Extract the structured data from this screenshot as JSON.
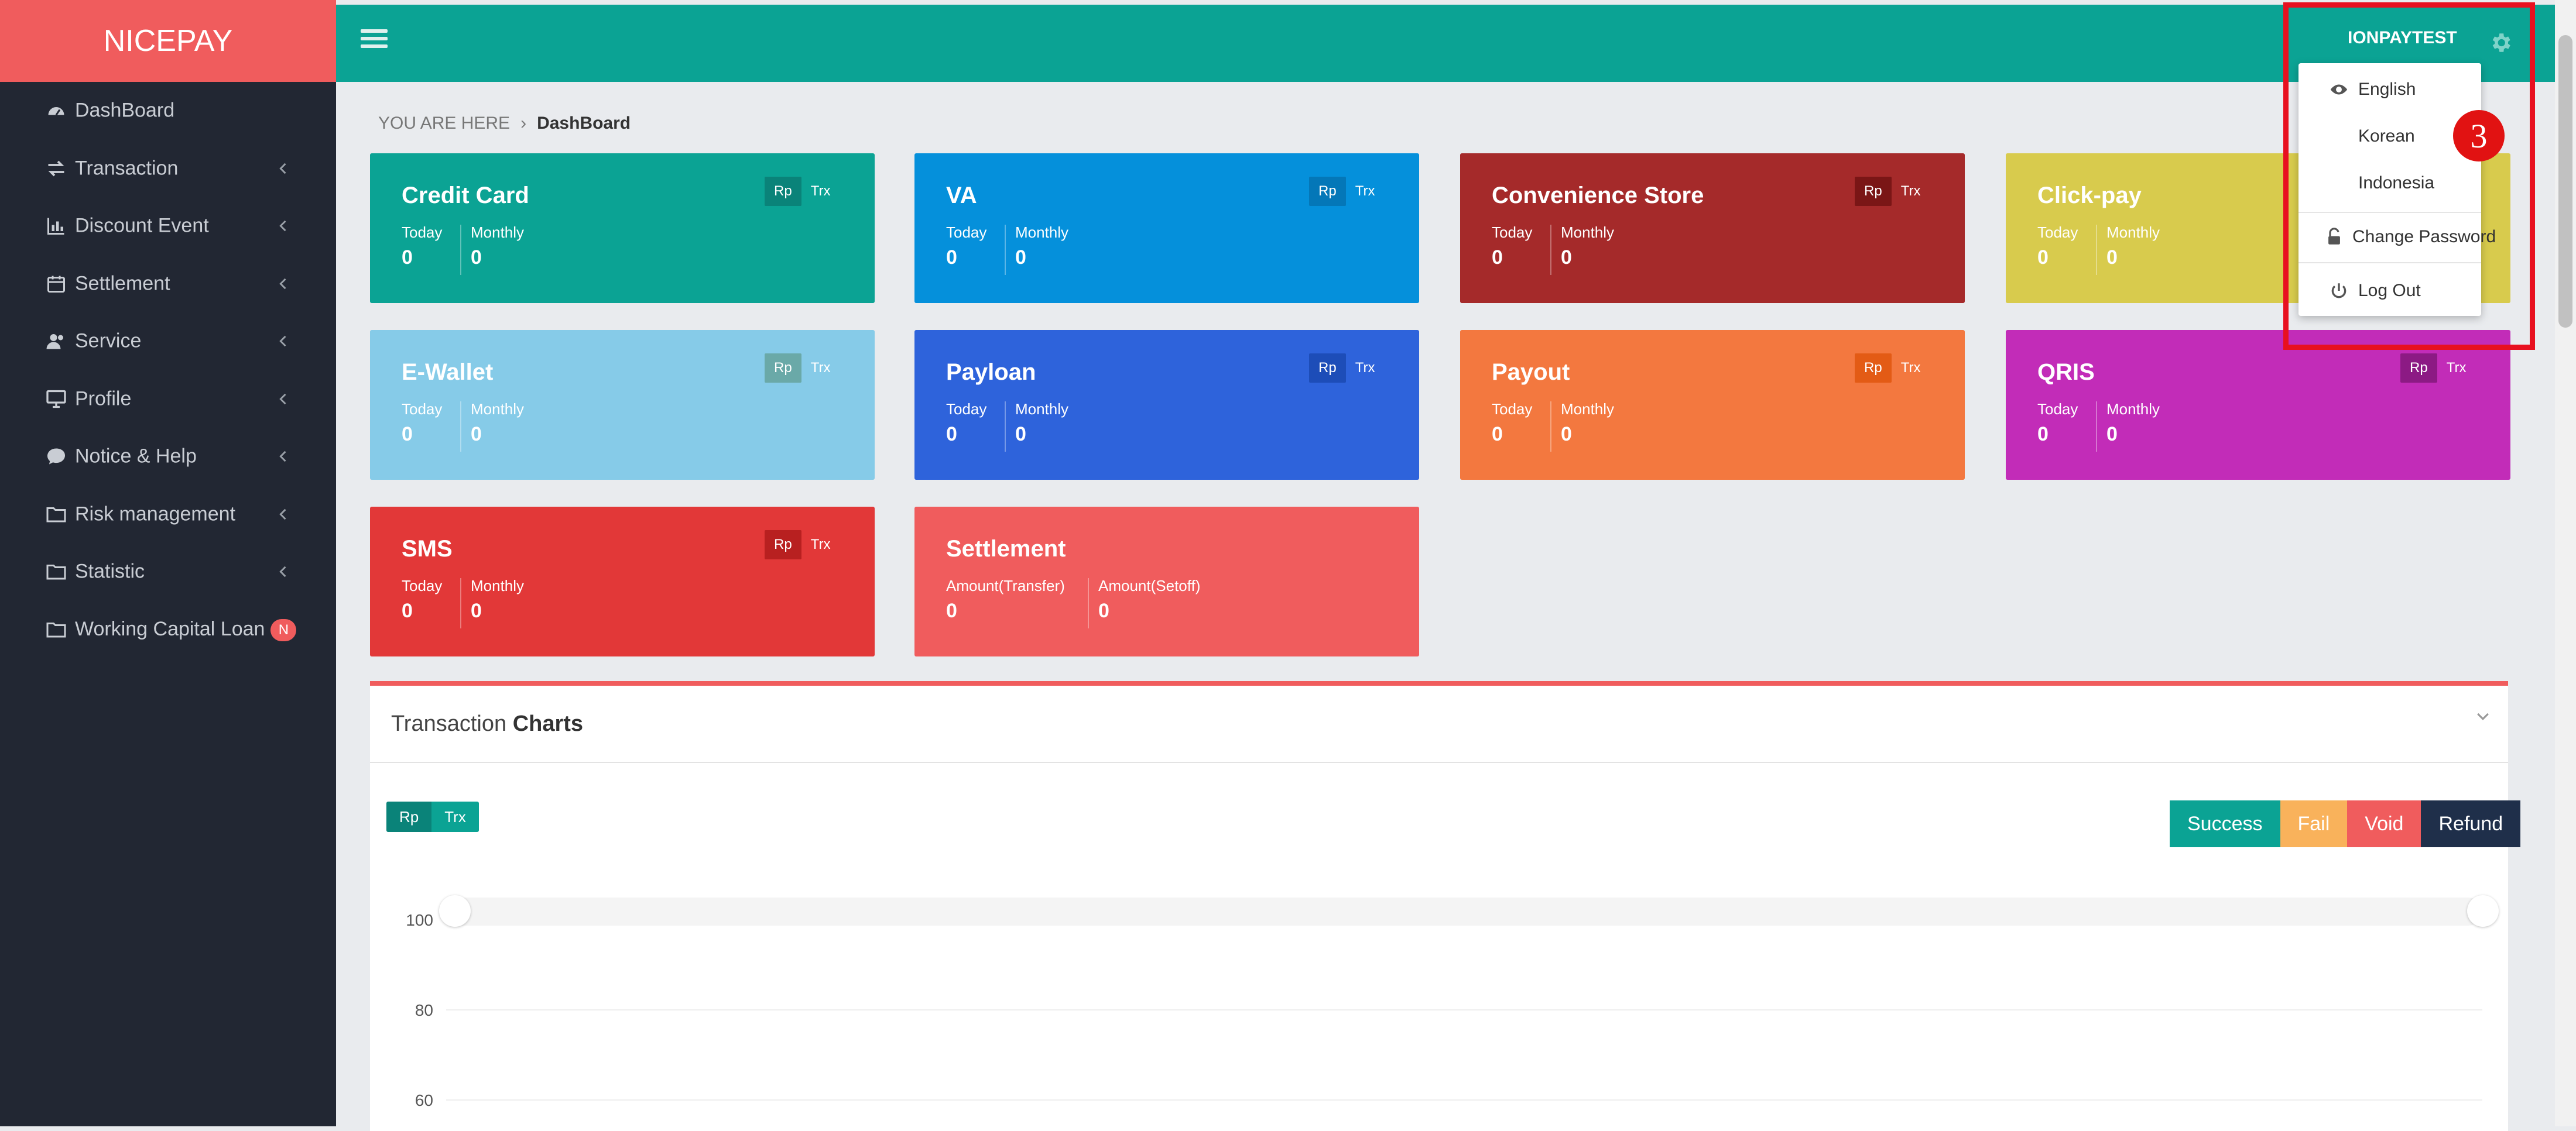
{
  "brand": "NICEPAY",
  "sidebar": {
    "items": [
      {
        "label": "DashBoard",
        "icon": "dashboard-icon",
        "chevron": false
      },
      {
        "label": "Transaction",
        "icon": "exchange-icon",
        "chevron": true
      },
      {
        "label": "Discount Event",
        "icon": "bar-chart-icon",
        "chevron": true
      },
      {
        "label": "Settlement",
        "icon": "calendar-icon",
        "chevron": true
      },
      {
        "label": "Service",
        "icon": "users-icon",
        "chevron": true
      },
      {
        "label": "Profile",
        "icon": "desktop-icon",
        "chevron": true
      },
      {
        "label": "Notice & Help",
        "icon": "comment-icon",
        "chevron": true
      },
      {
        "label": "Risk management",
        "icon": "folder-icon",
        "chevron": true
      },
      {
        "label": "Statistic",
        "icon": "folder-icon",
        "chevron": true
      },
      {
        "label": "Working Capital Loan",
        "icon": "folder-icon",
        "chevron": false,
        "badge": "N"
      }
    ]
  },
  "topbar": {
    "username": "IONPAYTEST"
  },
  "dropdown": {
    "languages": [
      "English",
      "Korean",
      "Indonesia"
    ],
    "change_password": "Change Password",
    "logout": "Log Out"
  },
  "annotation": {
    "step": "3"
  },
  "breadcrumb": {
    "prefix": "YOU ARE HERE",
    "separator": "›",
    "current": "DashBoard"
  },
  "cards": [
    {
      "title": "Credit Card",
      "label1": "Today",
      "label2": "Monthly",
      "value1": "0",
      "value2": "0",
      "color": "#0ba394",
      "badge_bg": "#0a8379",
      "rp": "Rp",
      "trx": "Trx"
    },
    {
      "title": "VA",
      "label1": "Today",
      "label2": "Monthly",
      "value1": "0",
      "value2": "0",
      "color": "#0590db",
      "badge_bg": "#0477b8",
      "rp": "Rp",
      "trx": "Trx"
    },
    {
      "title": "Convenience Store",
      "label1": "Today",
      "label2": "Monthly",
      "value1": "0",
      "value2": "0",
      "color": "#a52a2a",
      "badge_bg": "#7a1616",
      "rp": "Rp",
      "trx": "Trx"
    },
    {
      "title": "Click-pay",
      "label1": "Today",
      "label2": "Monthly",
      "value1": "0",
      "value2": "0",
      "color": "#d8cb4d",
      "badge_bg": "#b8ab34",
      "rp": "Rp",
      "trx": "Trx"
    },
    {
      "title": "E-Wallet",
      "label1": "Today",
      "label2": "Monthly",
      "value1": "0",
      "value2": "0",
      "color": "#86cbe8",
      "badge_bg": "#6aa9a8",
      "rp": "Rp",
      "trx": "Trx"
    },
    {
      "title": "Payloan",
      "label1": "Today",
      "label2": "Monthly",
      "value1": "0",
      "value2": "0",
      "color": "#2e63db",
      "badge_bg": "#1d4db8",
      "rp": "Rp",
      "trx": "Trx"
    },
    {
      "title": "Payout",
      "label1": "Today",
      "label2": "Monthly",
      "value1": "0",
      "value2": "0",
      "color": "#f3783f",
      "badge_bg": "#e35b15",
      "rp": "Rp",
      "trx": "Trx"
    },
    {
      "title": "QRIS",
      "label1": "Today",
      "label2": "Monthly",
      "value1": "0",
      "value2": "0",
      "color": "#c22cb8",
      "badge_bg": "#8c1a84",
      "rp": "Rp",
      "trx": "Trx"
    },
    {
      "title": "SMS",
      "label1": "Today",
      "label2": "Monthly",
      "value1": "0",
      "value2": "0",
      "color": "#e23838",
      "badge_bg": "#b82020",
      "rp": "Rp",
      "trx": "Trx"
    },
    {
      "title": "Settlement",
      "label1": "Amount(Transfer)",
      "label2": "Amount(Setoff)",
      "value1": "0",
      "value2": "0",
      "color": "#f05c5d"
    }
  ],
  "chart_panel": {
    "title_light": "Transaction",
    "title_bold": "Charts",
    "toggle": [
      "Rp",
      "Trx"
    ],
    "legend": [
      {
        "label": "Success",
        "color": "#0ba394"
      },
      {
        "label": "Fail",
        "color": "#f9b25b"
      },
      {
        "label": "Void",
        "color": "#f05c5d"
      },
      {
        "label": "Refund",
        "color": "#1f2f4a"
      }
    ]
  },
  "chart_data": {
    "type": "line",
    "title": "",
    "xlabel": "",
    "ylabel": "",
    "y_ticks": [
      100,
      80,
      60
    ],
    "series": [
      {
        "name": "Success",
        "values": []
      },
      {
        "name": "Fail",
        "values": []
      },
      {
        "name": "Void",
        "values": []
      },
      {
        "name": "Refund",
        "values": []
      }
    ]
  }
}
